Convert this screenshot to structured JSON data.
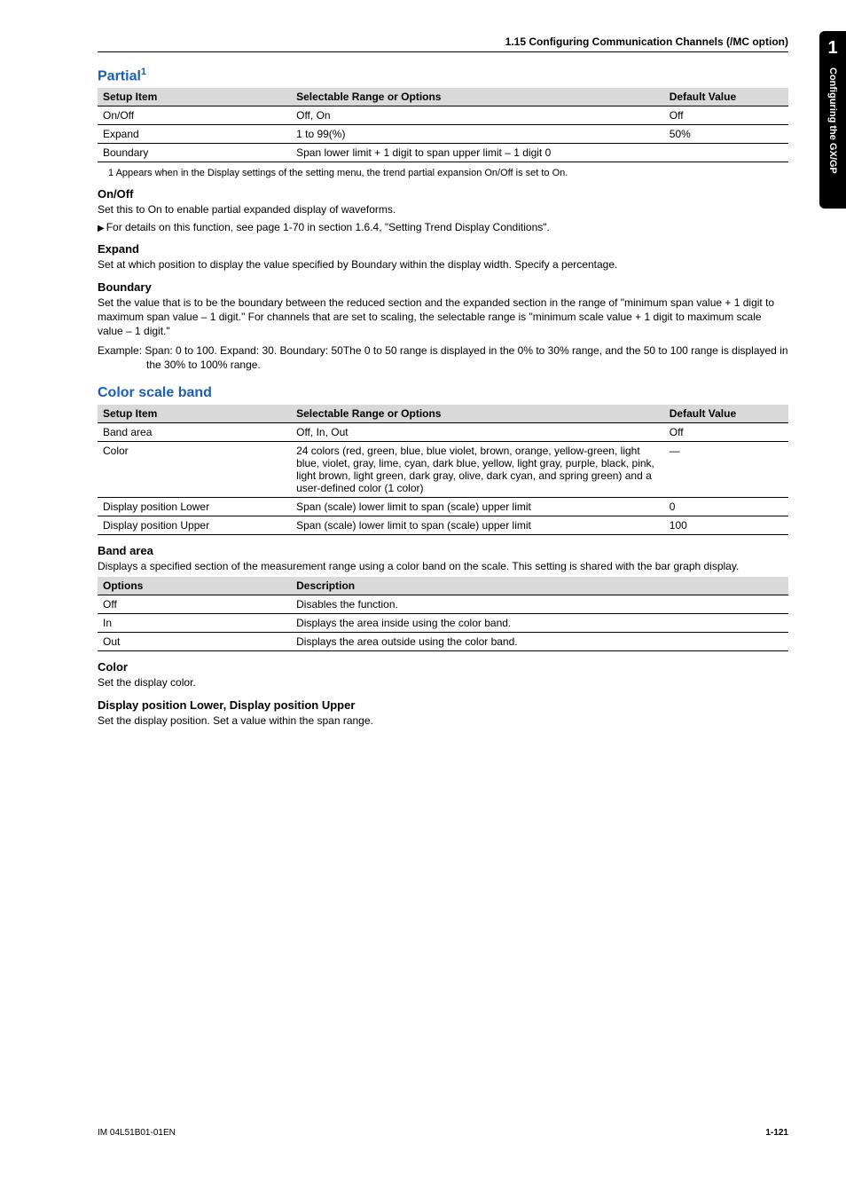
{
  "header": {
    "section_line": "1.15  Configuring Communication Channels (/MC option)"
  },
  "sidebar": {
    "chapter_num": "1",
    "vertical_text": "Configuring the GX/GP"
  },
  "partial": {
    "heading": "Partial",
    "sup": "1",
    "table": {
      "head": [
        "Setup Item",
        "Selectable Range or Options",
        "Default Value"
      ],
      "rows": [
        [
          "On/Off",
          "Off, On",
          "Off"
        ],
        [
          "Expand",
          "1 to 99(%)",
          "50%"
        ],
        [
          "Boundary",
          "Span lower limit + 1 digit to span upper limit – 1 digit 0",
          ""
        ]
      ]
    },
    "footnote": "1  Appears when in the Display settings of the setting menu, the trend partial expansion On/Off is set to On.",
    "onoff": {
      "head": "On/Off",
      "p1": "Set this to On to enable partial expanded display of waveforms.",
      "p2": "For details on this function, see page 1-70 in section 1.6.4, \"Setting Trend Display Conditions\"."
    },
    "expand": {
      "head": "Expand",
      "p1": "Set at which position to display the value specified by Boundary within the display width. Specify a percentage."
    },
    "boundary": {
      "head": "Boundary",
      "p1": "Set the value that is to be the boundary between the reduced section and the expanded section in the range of \"minimum span value + 1 digit to maximum span value – 1 digit.\" For channels that are set to scaling, the selectable range is \"minimum scale value + 1 digit to maximum scale value – 1 digit.\"",
      "example": "Example: Span: 0 to 100. Expand: 30. Boundary: 50The 0 to 50 range is displayed in the 0% to 30% range, and the 50 to 100 range is displayed in the 30% to 100% range."
    }
  },
  "colorscale": {
    "heading": "Color scale band",
    "table": {
      "head": [
        "Setup Item",
        "Selectable Range or Options",
        "Default Value"
      ],
      "rows": [
        [
          "Band area",
          "Off, In, Out",
          "Off"
        ],
        [
          "Color",
          "24 colors (red, green, blue, blue violet, brown, orange, yellow-green, light blue, violet, gray, lime, cyan, dark blue, yellow, light gray, purple, black, pink, light brown, light green, dark gray, olive, dark cyan, and spring green) and a user-defined color (1 color)",
          "—"
        ],
        [
          "Display position Lower",
          "Span (scale) lower limit to span (scale) upper limit",
          "0"
        ],
        [
          "Display position Upper",
          "Span (scale) lower limit to span (scale) upper limit",
          "100"
        ]
      ]
    },
    "bandarea": {
      "head": "Band area",
      "p1": "Displays a specified section of the measurement range using a color band on the scale. This setting is shared with the bar graph display.",
      "options_table": {
        "head": [
          "Options",
          "Description"
        ],
        "rows": [
          [
            "Off",
            "Disables the function."
          ],
          [
            "In",
            "Displays the area inside using the color band."
          ],
          [
            "Out",
            "Displays the area outside using the color band."
          ]
        ]
      }
    },
    "color": {
      "head": "Color",
      "p1": "Set the display color."
    },
    "disppos": {
      "head": "Display position Lower, Display position Upper",
      "p1": "Set the display position. Set a value within the span range."
    }
  },
  "footer": {
    "left": "IM 04L51B01-01EN",
    "right": "1-121"
  }
}
